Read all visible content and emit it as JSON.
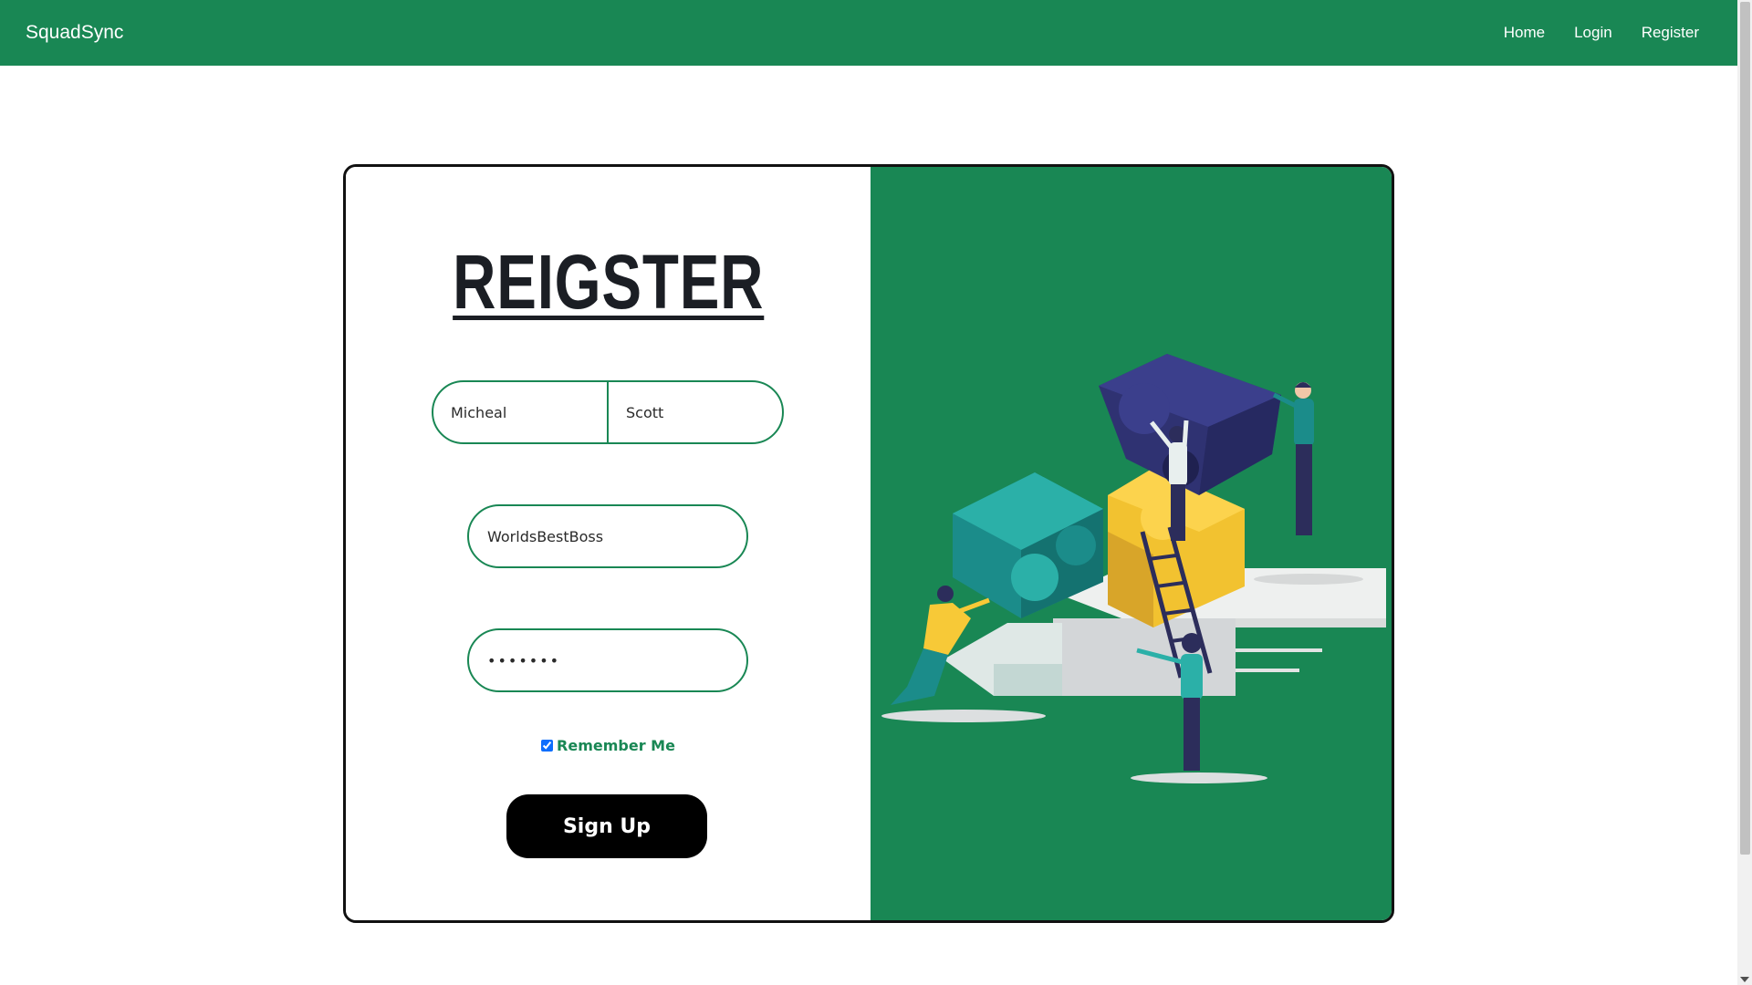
{
  "navbar": {
    "brand": "SquadSync",
    "links": [
      "Home",
      "Login",
      "Register"
    ]
  },
  "form": {
    "title": "REIGSTER",
    "first_name_value": "Micheal",
    "last_name_value": "Scott",
    "username_value": "WorldsBestBoss",
    "password_value": "•••••••",
    "remember_label": "Remember Me",
    "remember_checked": true,
    "submit_label": "Sign Up"
  },
  "colors": {
    "brand_green": "#198754",
    "button_black": "#000000",
    "checkbox_blue": "#0d6efd"
  },
  "illustration": {
    "icon": "teamwork-puzzle-illustration"
  }
}
